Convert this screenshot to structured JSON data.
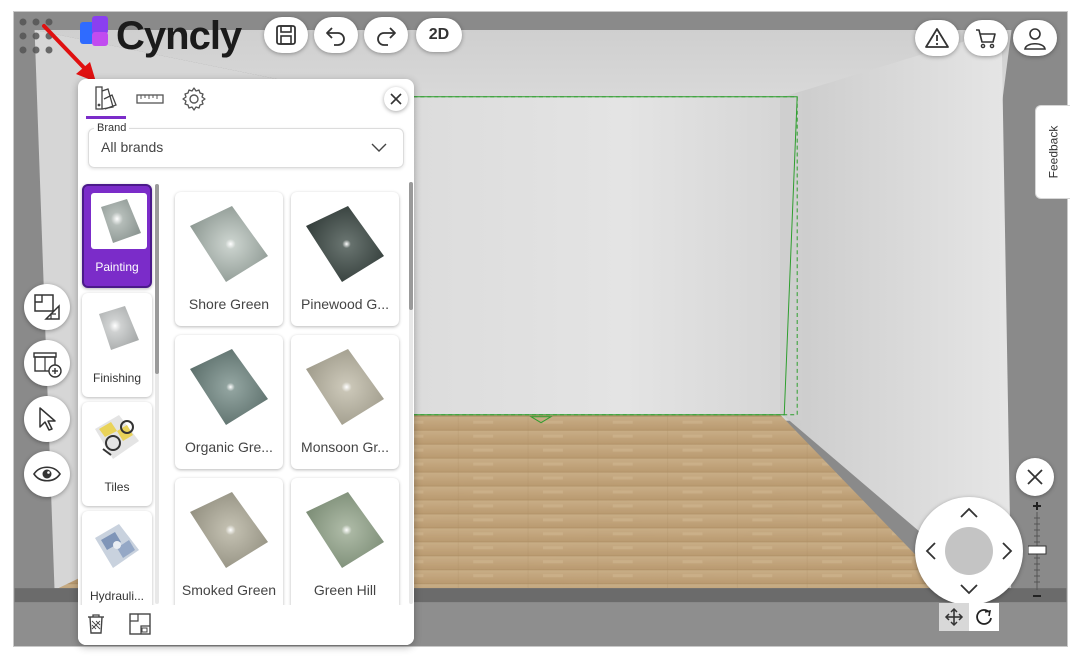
{
  "header": {
    "logo_text": "Cyncly",
    "view_mode_label": "2D"
  },
  "colors": {
    "accent": "#7b2cc9",
    "logo_blue": "#2f6bff",
    "logo_purple": "#8a3ff0",
    "outline_green": "#2e9e2e",
    "arrow_red": "#e01010"
  },
  "feedback": {
    "label": "Feedback"
  },
  "panel": {
    "tabs": [
      {
        "icon": "paint-swatch-icon",
        "active": true
      },
      {
        "icon": "ruler-icon",
        "active": false
      },
      {
        "icon": "gear-icon",
        "active": false
      }
    ],
    "brand": {
      "label": "Brand",
      "value": "All brands"
    },
    "categories": [
      {
        "label": "Painting",
        "active": true,
        "swatch": "#9ea8a4"
      },
      {
        "label": "Finishing",
        "active": false,
        "swatch": "#b9bcbc"
      },
      {
        "label": "Tiles",
        "active": false,
        "swatch": "#e9d35a"
      },
      {
        "label": "Hydrauli...",
        "active": false,
        "swatch": "#8aa0c0"
      }
    ],
    "materials": [
      {
        "label": "Shore Green",
        "color": "#9aa59f"
      },
      {
        "label": "Pinewood G...",
        "color": "#3f4a47"
      },
      {
        "label": "Organic Gre...",
        "color": "#6f837f"
      },
      {
        "label": "Monsoon Gr...",
        "color": "#b0ac9c"
      },
      {
        "label": "Smoked Green",
        "color": "#a5a394"
      },
      {
        "label": "Green Hill",
        "color": "#8c9d86"
      }
    ]
  }
}
